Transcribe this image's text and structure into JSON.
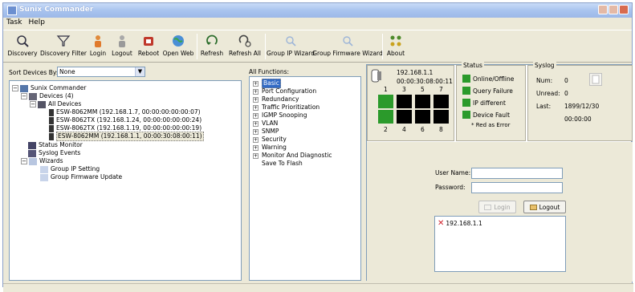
{
  "window": {
    "title": "Sunix Commander"
  },
  "menu": [
    "Task",
    "Help"
  ],
  "toolbar": {
    "buttons": [
      {
        "label": "Discovery",
        "icon": "magnifier-icon"
      },
      {
        "label": "Discovery Filter",
        "icon": "filter-icon"
      },
      {
        "label": "Login",
        "icon": "user-login-icon"
      },
      {
        "label": "Logout",
        "icon": "user-logout-icon"
      },
      {
        "label": "Reboot",
        "icon": "reboot-icon"
      },
      {
        "label": "Open Web",
        "icon": "globe-icon"
      },
      {
        "label": "Refresh",
        "icon": "refresh-icon"
      },
      {
        "label": "Refresh All",
        "icon": "refresh-all-icon"
      },
      {
        "label": "Group IP Wizard",
        "icon": "wizard-icon"
      },
      {
        "label": "Group Firmware Wizard",
        "icon": "wizard-icon"
      },
      {
        "label": "About",
        "icon": "about-icon"
      }
    ]
  },
  "sort": {
    "label": "Sort Devices By:",
    "value": "None"
  },
  "tree": {
    "root": "Sunix Commander",
    "devices": "Devices (4)",
    "all_devices": "All Devices",
    "items": [
      "ESW-8062MM (192.168.1.7, 00:00:00:00:00:07)",
      "ESW-8062TX (192.168.1.24, 00:00:00:00:00:24)",
      "ESW-8062TX (192.168.1.19, 00:00:00:00:00:19)",
      "ESW-8062MM (192.168.1.1, 00:00:30:08:00:11)"
    ],
    "status_monitor": "Status Monitor",
    "syslog_events": "Syslog Events",
    "wizards": "Wizards",
    "group_ip": "Group IP Setting",
    "group_fw": "Group Firmware Update"
  },
  "functions": {
    "label": "All Functions:",
    "items": [
      "Basic",
      "Port Configuration",
      "Redundancy",
      "Traffic Prioritization",
      "IGMP Snooping",
      "VLAN",
      "SNMP",
      "Security",
      "Warning",
      "Monitor And Diagnostic",
      "Save To Flash"
    ]
  },
  "device": {
    "ip": "192.168.1.1",
    "mac": "00:00:30:08:00:11",
    "top_ports": [
      "1",
      "3",
      "5",
      "7"
    ],
    "bottom_ports": [
      "2",
      "4",
      "6",
      "8"
    ]
  },
  "status": {
    "title": "Status",
    "rows": [
      "Online/Offline",
      "Query Failure",
      "IP different",
      "Device Fault"
    ],
    "note": "* Red as Error",
    "color_ok": "#2b9a2b"
  },
  "syslog": {
    "title": "Syslog",
    "num_label": "Num:",
    "num_value": "0",
    "unread_label": "Unread:",
    "unread_value": "0",
    "last_label": "Last:",
    "last_date": "1899/12/30",
    "last_time": "00:00:00"
  },
  "login": {
    "user_label": "User Name:",
    "pass_label": "Password:",
    "login_btn": "Login",
    "logout_btn": "Logout",
    "log_entry": "192.168.1.1"
  }
}
